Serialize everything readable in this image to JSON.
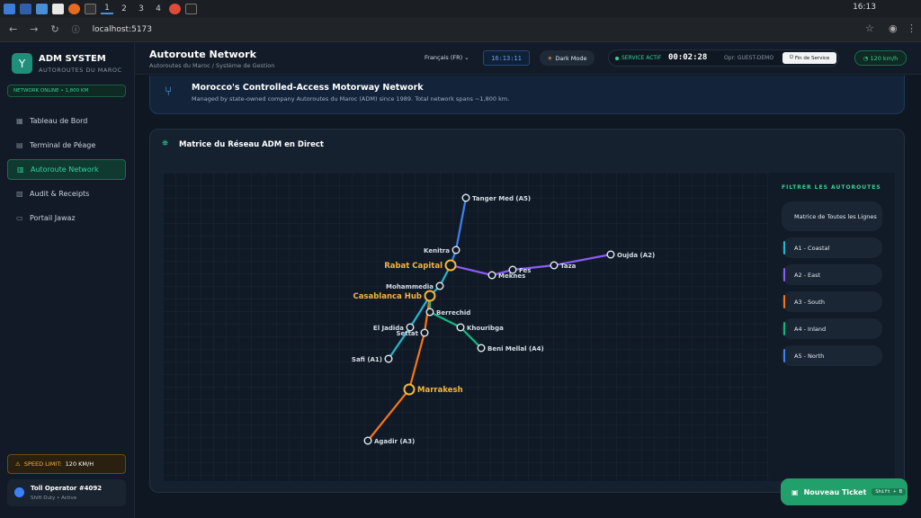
{
  "os": {
    "workspaces": [
      "1",
      "2",
      "3",
      "4"
    ],
    "clock": "16:13"
  },
  "browser": {
    "url": "localhost:5173"
  },
  "sidebar": {
    "brand": "ADM SYSTEM",
    "brand_sub": "AUTOROUTES DU MAROC",
    "network_badge": "NETWORK ONLINE • 1,800 KM",
    "items": [
      {
        "label": "Tableau de Bord",
        "icon": "grid-icon"
      },
      {
        "label": "Terminal de Péage",
        "icon": "toll-icon"
      },
      {
        "label": "Autoroute Network",
        "icon": "map-icon"
      },
      {
        "label": "Audit & Receipts",
        "icon": "receipt-icon"
      },
      {
        "label": "Portail Jawaz",
        "icon": "card-icon"
      }
    ],
    "speed_limit_label": "SPEED LIMIT:",
    "speed_limit_value": "120 KM/H",
    "operator_name": "Toll Operator #4092",
    "operator_status": "Shift Duty • Active"
  },
  "header": {
    "title": "Autoroute Network",
    "breadcrumb": "Autoroutes du Maroc / Système de Gestion",
    "language": "Français (FR)",
    "clock": "16:13:11",
    "dark_mode_label": "Dark Mode",
    "service_label": "SERVICE ACTIF",
    "service_timer": "00:02:28",
    "operator": "Opr: GUEST-DEMO",
    "end_service": "Fin de Service",
    "speed": "120 km/h"
  },
  "info": {
    "title": "Morocco's Controlled-Access Motorway Network",
    "description": "Managed by state-owned company Autoroutes du Maroc (ADM) since 1989. Total network spans ~1,800 km."
  },
  "matrix": {
    "title": "Matrice du Réseau ADM en Direct",
    "filter_title": "FILTRER LES AUTOROUTES",
    "filter_all": "Matrice de Toutes les Lignes",
    "filters": [
      {
        "label": "A1 - Coastal",
        "color": "#22b8cf"
      },
      {
        "label": "A2 - East",
        "color": "#8b5cf6"
      },
      {
        "label": "A3 - South",
        "color": "#f97316"
      },
      {
        "label": "A4 - Inland",
        "color": "#10b981"
      },
      {
        "label": "A5 - North",
        "color": "#3b82f6"
      }
    ],
    "cities": [
      {
        "name": "Tanger Med (A5)",
        "major": false
      },
      {
        "name": "Kenitra",
        "major": false
      },
      {
        "name": "Rabat Capital",
        "major": true
      },
      {
        "name": "Mohammedia",
        "major": false
      },
      {
        "name": "Casablanca Hub",
        "major": true
      },
      {
        "name": "Berrechid",
        "major": false
      },
      {
        "name": "El Jadida",
        "major": false
      },
      {
        "name": "Settat",
        "major": false
      },
      {
        "name": "Khouribga",
        "major": false
      },
      {
        "name": "Beni Mellal (A4)",
        "major": false
      },
      {
        "name": "Safi (A1)",
        "major": false
      },
      {
        "name": "Marrakesh",
        "major": true
      },
      {
        "name": "Agadir (A3)",
        "major": false
      },
      {
        "name": "Meknes",
        "major": false
      },
      {
        "name": "Fes",
        "major": false
      },
      {
        "name": "Taza",
        "major": false
      },
      {
        "name": "Oujda (A2)",
        "major": false
      }
    ]
  },
  "fab": {
    "label": "Nouveau Ticket",
    "shortcut": "Shift + B"
  }
}
